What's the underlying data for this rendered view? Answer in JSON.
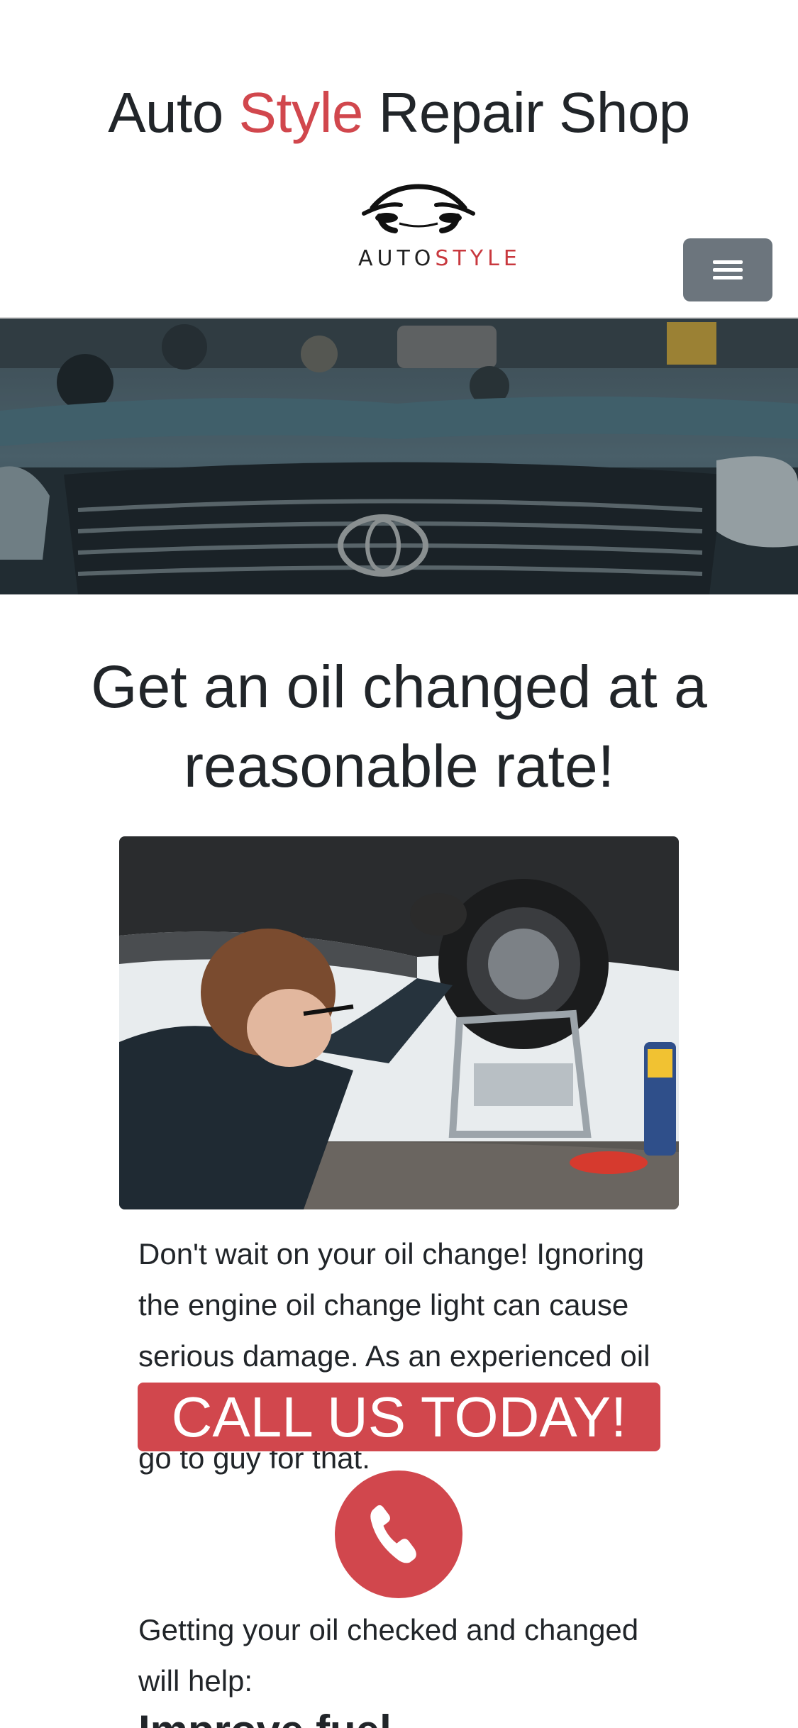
{
  "header": {
    "title_pre": "Auto ",
    "title_accent": "Style",
    "title_post": " Repair Shop",
    "logo_text_auto": "AUTO",
    "logo_text_style": "STYLE"
  },
  "main": {
    "headline": "Get an oil changed at a reasonable rate!",
    "paragraph_1": "Don't wait on your oil change! Ignoring the engine oil change light can cause serious damage. As an experienced oil change mechanic, we are your number go to guy for that.",
    "paragraph_2": "Getting your oil checked and changed will help:",
    "paragraph_3": "Improve fuel"
  },
  "cta": {
    "banner_label": "CALL US TODAY!"
  },
  "icons": {
    "menu": "hamburger-icon",
    "call": "phone-icon"
  },
  "colors": {
    "accent": "#d1474d",
    "menu_button": "#6c757d",
    "text": "#212529"
  }
}
